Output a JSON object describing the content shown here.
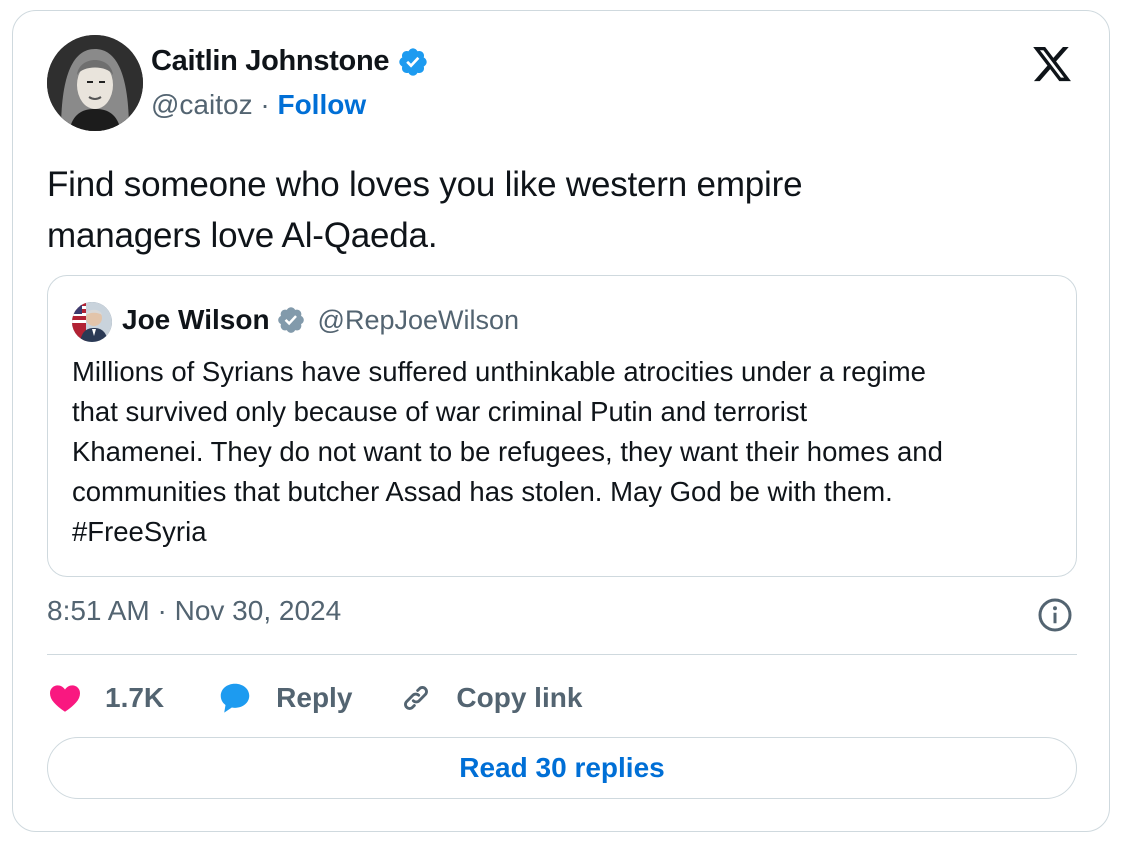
{
  "author": {
    "display_name": "Caitlin Johnstone",
    "handle": "@caitoz",
    "separator": "·",
    "follow_label": "Follow",
    "verified_color": "#1d9bf0"
  },
  "tweet": {
    "text_line1": "Find someone who loves you like western empire",
    "text_line2": "managers love Al-Qaeda."
  },
  "quoted_tweet": {
    "display_name": "Joe Wilson",
    "handle": "@RepJoeWilson",
    "verified_color": "#829aab",
    "lines": [
      "Millions of Syrians have suffered unthinkable atrocities under a regime",
      "that survived only because of war criminal Putin and terrorist",
      "Khamenei. They do not want to be refugees, they want their homes and",
      "communities that butcher Assad has stolen. May God be with them.",
      "#FreeSyria"
    ]
  },
  "timestamp": "8:51 AM · Nov 30, 2024",
  "actions": {
    "like_count": "1.7K",
    "reply_label": "Reply",
    "copy_link_label": "Copy link"
  },
  "read_replies_label": "Read 30 replies",
  "colors": {
    "like": "#f91880",
    "reply": "#1d9bf0",
    "link": "#006fd6",
    "secondary_text": "#536471",
    "border": "#cfd9de"
  }
}
